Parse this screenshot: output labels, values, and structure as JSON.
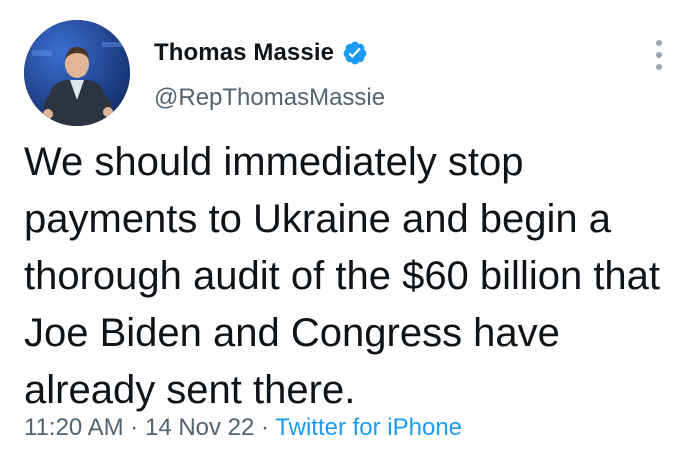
{
  "tweet": {
    "author": {
      "display_name": "Thomas Massie",
      "handle": "@RepThomasMassie",
      "verified": true,
      "verified_icon": "verified-badge-icon",
      "avatar_icon": "profile-photo"
    },
    "text": "We should immediately stop payments to Ukraine and begin a thorough audit of the $60 billion that Joe Biden and Congress have already sent there.",
    "time": "11:20 AM",
    "separator": "·",
    "date": "14 Nov 22",
    "source": "Twitter for iPhone",
    "more_icon": "more-options-icon"
  },
  "colors": {
    "text": "#0f1419",
    "secondary": "#536471",
    "link": "#1d9bf0",
    "verified": "#1d9bf0"
  }
}
